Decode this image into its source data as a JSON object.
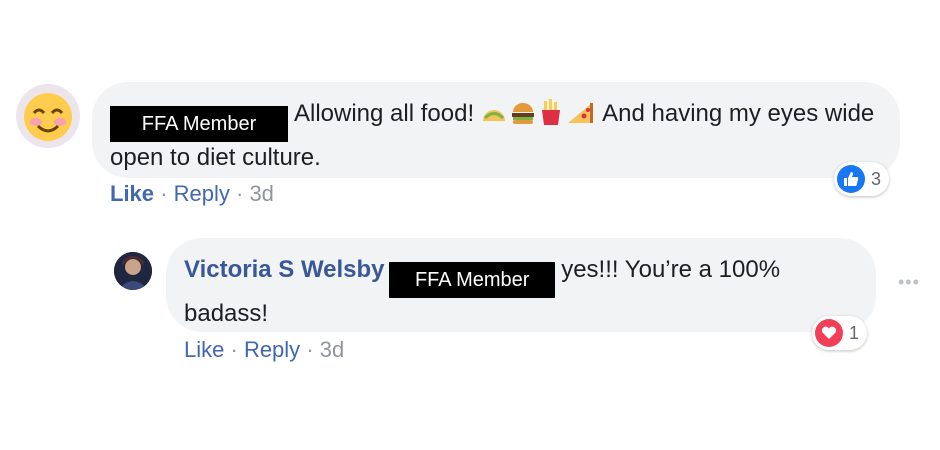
{
  "comment": {
    "redaction_label": "FFA Member",
    "text_part1": "Allowing all food!",
    "emojis": [
      "taco-emoji",
      "burger-emoji",
      "fries-emoji",
      "pizza-emoji"
    ],
    "text_part2": "And having my eyes wide open to diet culture.",
    "actions": {
      "like": "Like",
      "reply": "Reply",
      "time": "3d"
    },
    "reaction": {
      "type": "like",
      "count": "3",
      "color": "#1877f2"
    }
  },
  "reply": {
    "author": "Victoria S Welsby",
    "redaction_label": "FFA Member",
    "text": "yes!!! You’re a 100% badass!",
    "actions": {
      "like": "Like",
      "reply": "Reply",
      "time": "3d"
    },
    "reaction": {
      "type": "love",
      "count": "1",
      "color": "#f33e58"
    },
    "more_icon": "more-options-icon"
  }
}
